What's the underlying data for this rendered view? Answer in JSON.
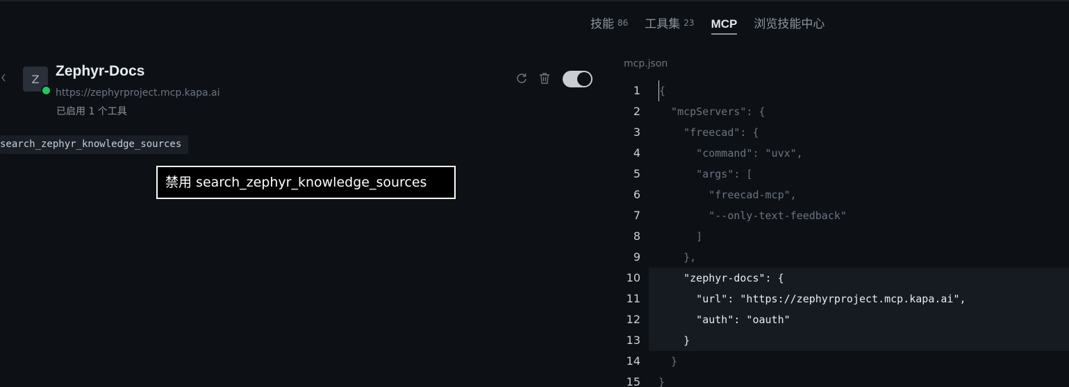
{
  "tabs": [
    {
      "label": "技能",
      "count": "86"
    },
    {
      "label": "工具集",
      "count": "23"
    },
    {
      "label": "MCP"
    },
    {
      "label": "浏览技能中心"
    }
  ],
  "server": {
    "avatar_letter": "Z",
    "title": "Zephyr-Docs",
    "url": "https://zephyrproject.mcp.kapa.ai",
    "enabled_text": "已启用 1 个工具",
    "tool_chip": "search_zephyr_knowledge_sources",
    "tooltip": "禁用 search_zephyr_knowledge_sources",
    "toggle_on": true
  },
  "icons": {
    "back": "chevron-left-icon",
    "refresh": "refresh-icon",
    "delete": "trash-icon",
    "status": "online-status-dot",
    "status_color": "#22c55e"
  },
  "editor": {
    "filename": "mcp.json",
    "lines": [
      {
        "num": "1",
        "text": "{"
      },
      {
        "num": "2",
        "text": "  \"mcpServers\": {"
      },
      {
        "num": "3",
        "text": "    \"freecad\": {"
      },
      {
        "num": "4",
        "text": "      \"command\": \"uvx\","
      },
      {
        "num": "5",
        "text": "      \"args\": ["
      },
      {
        "num": "6",
        "text": "        \"freecad-mcp\","
      },
      {
        "num": "7",
        "text": "        \"--only-text-feedback\""
      },
      {
        "num": "8",
        "text": "      ]"
      },
      {
        "num": "9",
        "text": "    },"
      },
      {
        "num": "10",
        "text": "    \"zephyr-docs\": {"
      },
      {
        "num": "11",
        "text": "      \"url\": \"https://zephyrproject.mcp.kapa.ai\","
      },
      {
        "num": "12",
        "text": "      \"auth\": \"oauth\""
      },
      {
        "num": "13",
        "text": "    }"
      },
      {
        "num": "14",
        "text": "  }"
      },
      {
        "num": "15",
        "text": "}"
      }
    ]
  }
}
